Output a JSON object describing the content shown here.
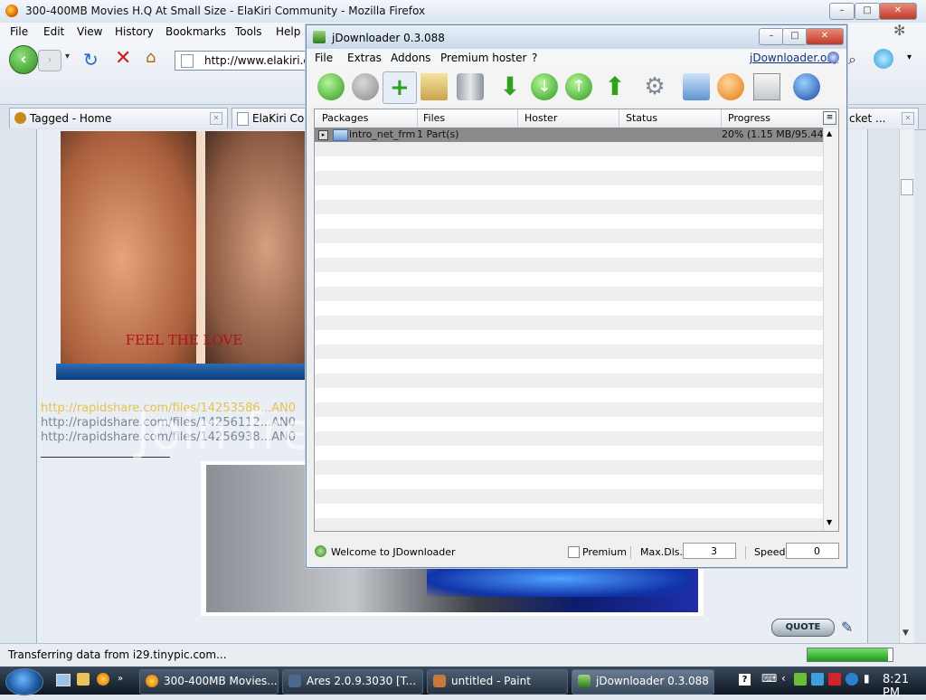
{
  "firefox": {
    "title": "300-400MB Movies H.Q At Small Size - ElaKiri Community - Mozilla Firefox",
    "menu": [
      "File",
      "Edit",
      "View",
      "History",
      "Bookmarks",
      "Tools",
      "Help"
    ],
    "url": "http://www.elakiri.c",
    "tabs": [
      {
        "label": "Tagged - Home"
      },
      {
        "label": "ElaKiri Co"
      },
      {
        "label": "cket ..."
      }
    ],
    "status_text": "Transferring data from i29.tinypic.com...",
    "progress_fraction": 0.95
  },
  "page": {
    "poster_caption": "FEEL THE LOVE",
    "links": [
      "http://rapidshare.com/files/14253586...AN0",
      "http://rapidshare.com/files/14256112...AN0",
      "http://rapidshare.com/files/14256938...AN0"
    ],
    "quote_label": "QUOTE"
  },
  "watermark": {
    "brand": "photobucket",
    "tagline": "Join free. Share privately."
  },
  "jdownloader": {
    "title": "jDownloader 0.3.088",
    "menu": [
      "File",
      "Extras",
      "Addons",
      "Premium hoster",
      "?"
    ],
    "link": "jDownloader.org",
    "columns": [
      "Packages",
      "Files",
      "Hoster",
      "Status",
      "Progress"
    ],
    "rows": [
      {
        "package": "intro_net_frmw",
        "files": "1 Part(s)",
        "hoster": "",
        "status": "",
        "progress": "20% (1.15 MB/95.44 M"
      }
    ],
    "status": {
      "welcome": "Welcome to JDownloader",
      "premium_label": "Premium",
      "maxdls_label": "Max.Dls.",
      "maxdls_value": "3",
      "speed_label": "Speed",
      "speed_value": "0"
    }
  },
  "taskbar": {
    "items": [
      "300-400MB Movies...",
      "Ares 2.0.9.3030  [T...",
      "untitled - Paint",
      "jDownloader 0.3.088"
    ],
    "clock": "8:21 PM"
  }
}
